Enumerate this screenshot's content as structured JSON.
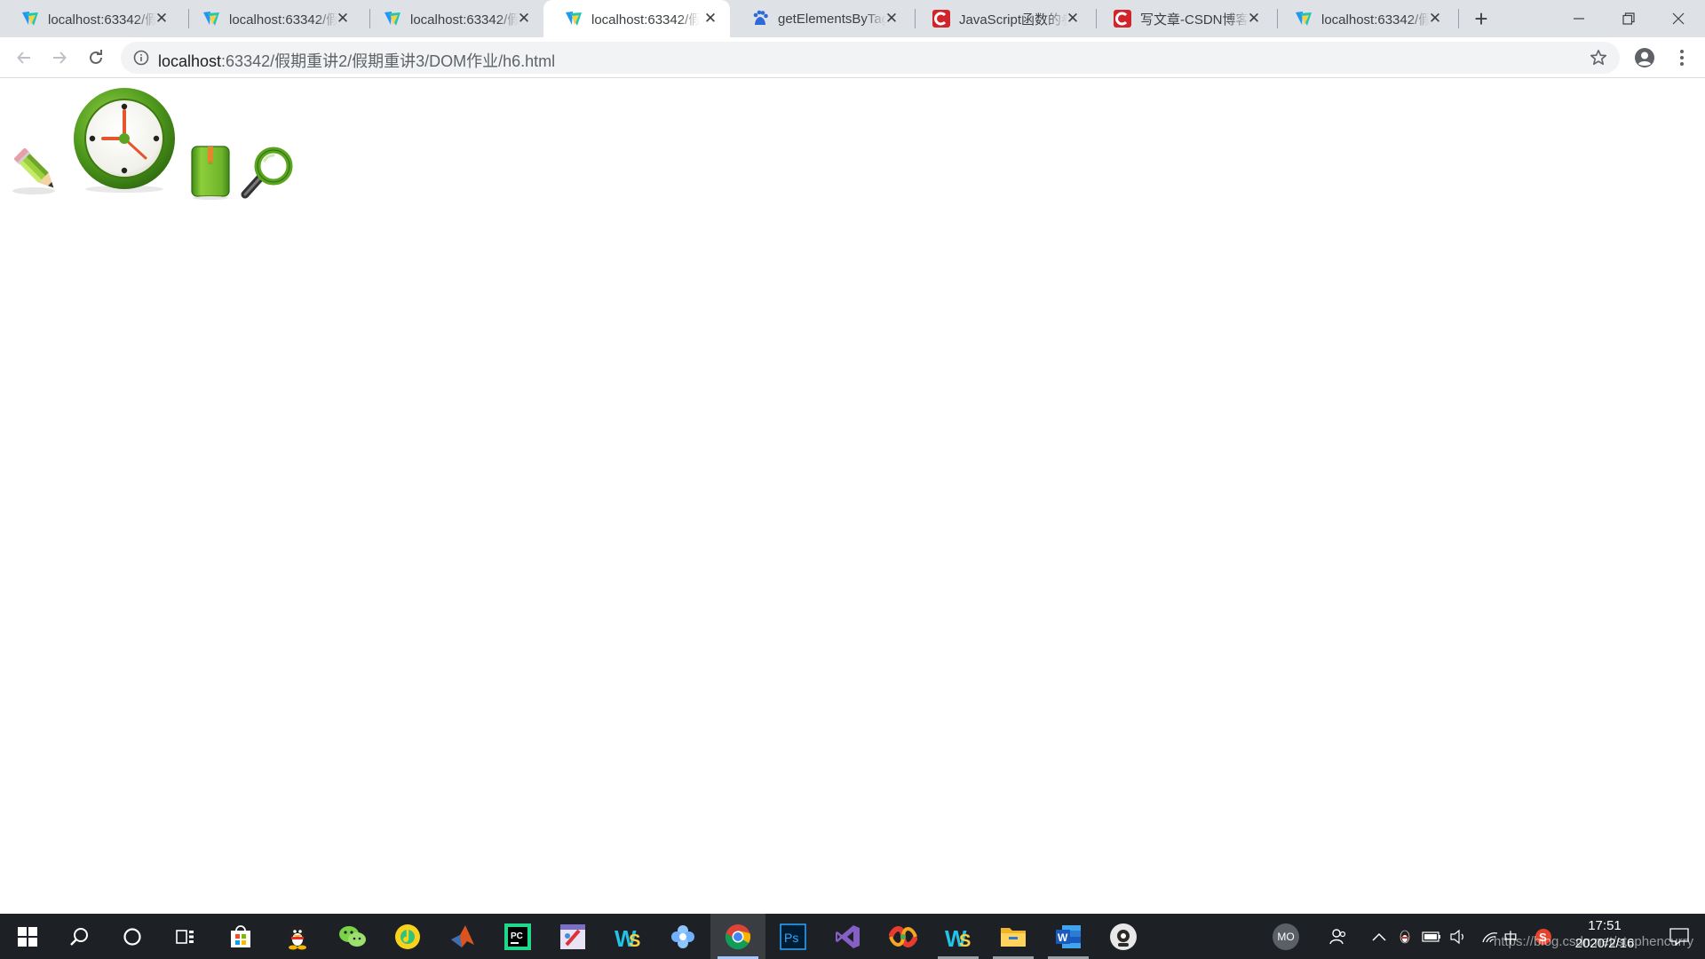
{
  "browser": {
    "tabs": [
      {
        "title": "localhost:63342/假",
        "favicon": "webstorm-icon",
        "active": false
      },
      {
        "title": "localhost:63342/假",
        "favicon": "webstorm-icon",
        "active": false
      },
      {
        "title": "localhost:63342/假",
        "favicon": "webstorm-icon",
        "active": false
      },
      {
        "title": "localhost:63342/假",
        "favicon": "webstorm-icon",
        "active": true
      },
      {
        "title": "getElementsByTagName",
        "favicon": "baidu-icon",
        "active": false
      },
      {
        "title": "JavaScript函数的参数",
        "favicon": "csdn-icon",
        "active": false
      },
      {
        "title": "写文章-CSDN博客",
        "favicon": "csdn-icon",
        "active": false
      },
      {
        "title": "localhost:63342/假",
        "favicon": "webstorm-icon",
        "active": false
      }
    ],
    "tab_close_glyph": "✕",
    "new_tab_glyph": "+",
    "url_host": "localhost",
    "url_path": ":63342/假期重讲2/假期重讲3/DOM作业/h6.html"
  },
  "page": {
    "images": [
      "pencil-icon",
      "clock-icon",
      "book-icon",
      "magnifier-icon"
    ]
  },
  "taskbar": {
    "apps": [
      "start-icon",
      "search-icon",
      "cortana-icon",
      "task-view-icon",
      "store-icon",
      "qq-icon",
      "wechat-icon",
      "qq-music-icon",
      "matlab-icon",
      "pycharm-icon",
      "paint-icon",
      "webstorm-icon",
      "flower-app-icon",
      "chrome-icon",
      "photoshop-icon",
      "visual-studio-icon",
      "xmind-icon",
      "webstorm-icon",
      "file-explorer-icon",
      "word-icon",
      "camera-app-icon"
    ],
    "tray_avatar": "MO",
    "ime": "中",
    "time": "17:51",
    "date": "2020/2/16"
  },
  "watermark": "https://blog.csdn.net/stephencurry"
}
